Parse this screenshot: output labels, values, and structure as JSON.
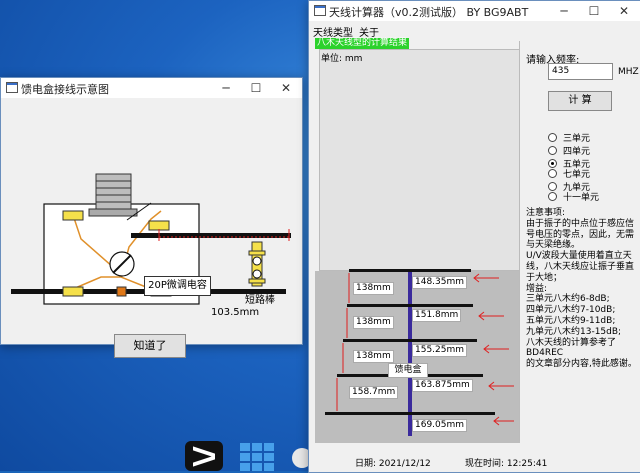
{
  "taskbar": {
    "icons": [
      "capcut-icon",
      "grid-app-icon",
      "circle-app-icon"
    ]
  },
  "diagram_window": {
    "title": "馈电盒接线示意图",
    "capacitor_label": "20P微调电容",
    "dimension_label": "103.5mm",
    "short_label": "短路棒",
    "ok_button": "知道了"
  },
  "calc_window": {
    "title": "天线计算器（v0.2测试版）  BY BG9ABT",
    "menu": [
      "天线类型",
      "关于"
    ],
    "status": "八木天线型的计算结果",
    "unit": "单位: mm",
    "freq_label": "请输入频率:",
    "freq_value": "435",
    "freq_unit": "MHZ",
    "calc_button": "计 算",
    "radio_options": [
      "三单元",
      "四单元",
      "五单元",
      "七单元",
      "九单元",
      "十一单元"
    ],
    "selected_index": 2,
    "notes": "注意事项:\n由于振子的中点位于感应信号电压的零点，因此，无需与天梁绝缘。\nU/V波段大量使用着直立天线，八木天线应让振子垂直于大地；\n增益:\n三单元八木约6-8dB;\n四单元八木约7-10dB;\n五单元八木约9-11dB;\n九单元八木约13-15dB;\n八木天线的计算参考了BD4REC\n的文章部分内容,特此感谢。",
    "element_lengths": [
      "148.35mm",
      "151.8mm",
      "155.25mm",
      "163.875mm",
      "169.05mm"
    ],
    "spacings": [
      "138mm",
      "138mm",
      "138mm",
      "158.7mm"
    ],
    "feed_label": "馈电盒",
    "date_label": "日期:  2021/12/12",
    "time_label": "现在时间:  12:25:41"
  },
  "colors": {
    "desktop": "#1a64b8",
    "boom": "#3a2a9c",
    "arrow": "#e02020",
    "highlight": "#2bd22b"
  }
}
